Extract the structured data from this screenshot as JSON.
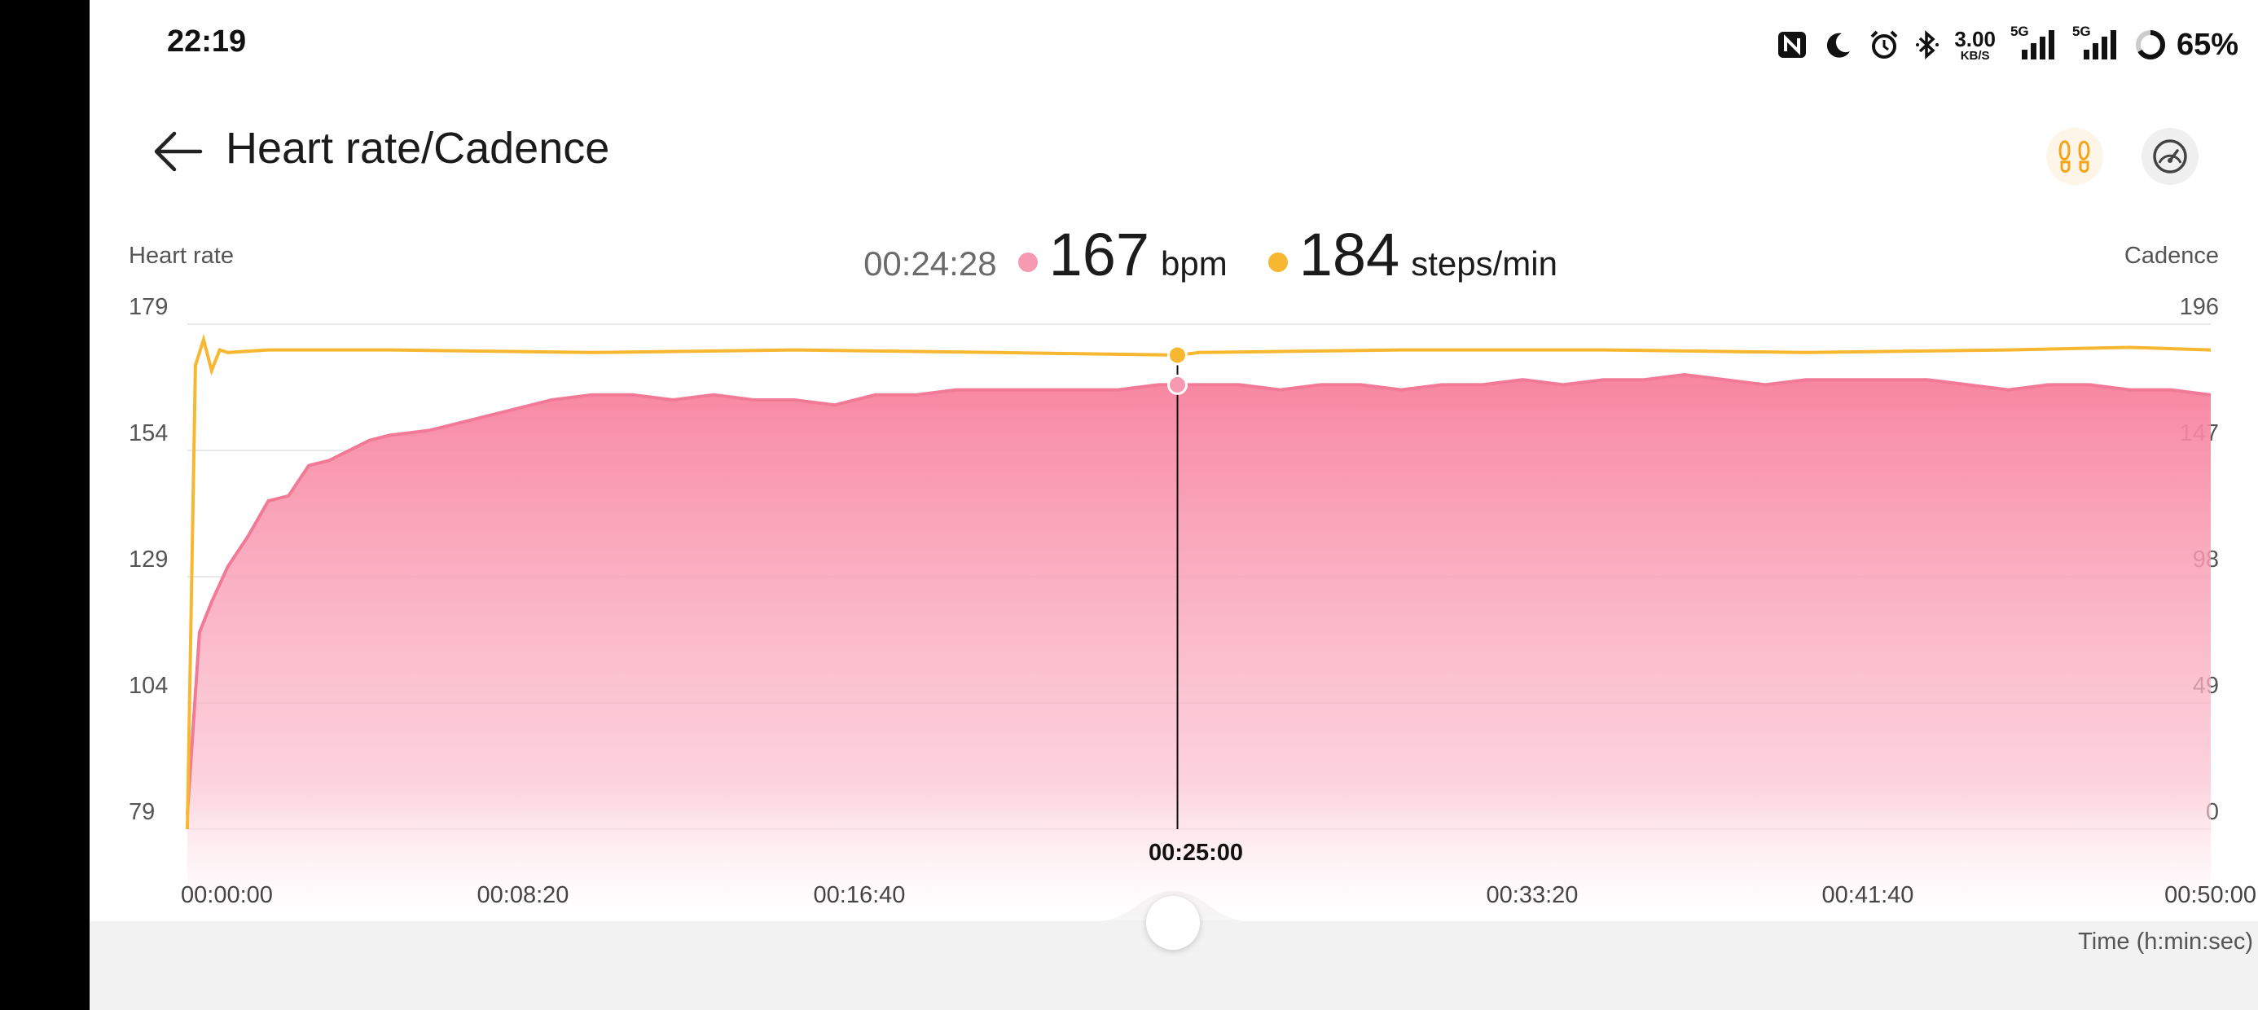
{
  "status_bar": {
    "time": "22:19",
    "net_speed_value": "3.00",
    "net_speed_unit": "KB/S",
    "signal_tag_1": "5G",
    "signal_tag_2": "5G",
    "battery": "65%",
    "icons": [
      "nfc-icon",
      "moon-icon",
      "alarm-icon",
      "bluetooth-icon",
      "signal-icon",
      "signal-icon",
      "battery-ring-icon"
    ]
  },
  "header": {
    "title": "Heart rate/Cadence",
    "back_icon": "arrow-left-icon",
    "cadence_toggle_icon": "footprints-icon",
    "speed_toggle_icon": "speedometer-icon"
  },
  "readout": {
    "time": "00:24:28",
    "heart_rate_value": "167",
    "heart_rate_unit": "bpm",
    "cadence_value": "184",
    "cadence_unit": "steps/min"
  },
  "colors": {
    "heart_rate": "#f27a96",
    "heart_rate_dot": "#f59ab0",
    "cadence": "#f7b731",
    "gridline": "#e8e8e8"
  },
  "chart_data": {
    "type": "area",
    "left_axis_title": "Heart rate",
    "right_axis_title": "Cadence",
    "x_axis_title": "Time (h:min:sec)",
    "left_ticks": [
      "179",
      "154",
      "129",
      "104",
      "79"
    ],
    "right_ticks": [
      "196",
      "147",
      "98",
      "49",
      "0"
    ],
    "left_ylim": [
      79,
      179
    ],
    "right_ylim": [
      0,
      196
    ],
    "x_ticks": [
      "00:00:00",
      "00:08:20",
      "00:16:40",
      "00:25:00",
      "00:33:20",
      "00:41:40",
      "00:50:00"
    ],
    "xlim_minutes": [
      0,
      50
    ],
    "cursor": {
      "time": "00:24:28",
      "heart_rate": 167,
      "cadence": 184
    },
    "grid": true,
    "series": [
      {
        "name": "Heart rate",
        "unit": "bpm",
        "x_minutes": [
          0,
          0.3,
          0.6,
          1.0,
          1.5,
          2.0,
          2.5,
          3.0,
          3.5,
          4.0,
          4.5,
          5.0,
          6.0,
          7.0,
          8.0,
          9.0,
          10.0,
          11.0,
          12.0,
          13.0,
          14.0,
          15.0,
          16.0,
          17.0,
          18.0,
          19.0,
          20.0,
          21.0,
          22.0,
          23.0,
          24.0,
          24.5,
          25.0,
          26.0,
          27.0,
          28.0,
          29.0,
          30.0,
          31.0,
          32.0,
          33.0,
          34.0,
          35.0,
          36.0,
          37.0,
          38.0,
          39.0,
          40.0,
          41.0,
          42.0,
          43.0,
          44.0,
          45.0,
          46.0,
          47.0,
          48.0,
          49.0,
          50.0
        ],
        "values": [
          82,
          118,
          124,
          131,
          137,
          144,
          145,
          151,
          152,
          154,
          156,
          157,
          158,
          160,
          162,
          164,
          165,
          165,
          164,
          165,
          164,
          164,
          163,
          165,
          165,
          166,
          166,
          166,
          166,
          166,
          167,
          167,
          167,
          167,
          166,
          167,
          167,
          166,
          167,
          167,
          168,
          167,
          168,
          168,
          169,
          168,
          167,
          168,
          168,
          168,
          168,
          167,
          166,
          167,
          167,
          166,
          166,
          165
        ]
      },
      {
        "name": "Cadence",
        "unit": "steps/min",
        "x_minutes": [
          0,
          0.2,
          0.4,
          0.6,
          0.8,
          1.0,
          2.0,
          5.0,
          10.0,
          15.0,
          20.0,
          24.5,
          25.0,
          30.0,
          35.0,
          40.0,
          45.0,
          48.0,
          50.0
        ],
        "values": [
          0,
          180,
          190,
          178,
          186,
          185,
          186,
          186,
          185,
          186,
          185,
          184,
          185,
          186,
          186,
          185,
          186,
          187,
          186
        ]
      }
    ]
  }
}
